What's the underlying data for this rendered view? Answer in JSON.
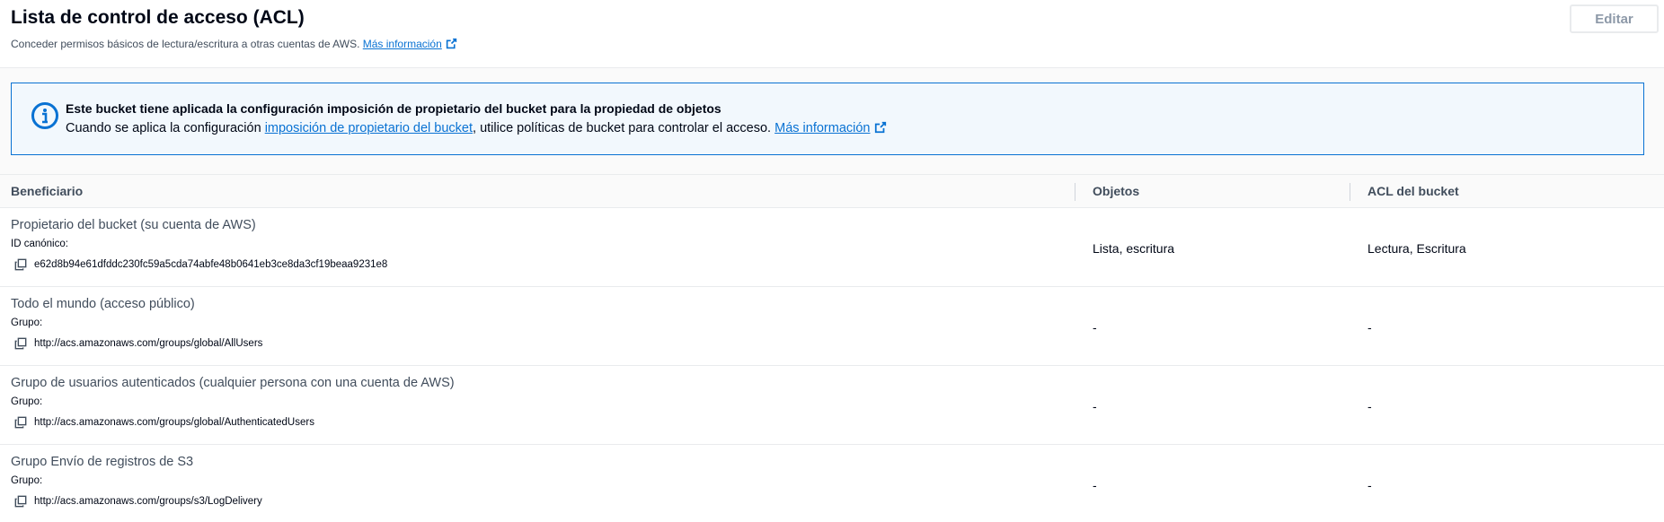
{
  "header": {
    "title": "Lista de control de acceso (ACL)",
    "description": "Conceder permisos básicos de lectura/escritura a otras cuentas de AWS.",
    "more_info_link": "Más información",
    "edit_button": "Editar"
  },
  "info_alert": {
    "icon": "info-icon",
    "title": "Este bucket tiene aplicada la configuración imposición de propietario del bucket para la propiedad de objetos",
    "body_prefix": "Cuando se aplica la configuración",
    "body_link": "imposición de propietario del bucket",
    "body_suffix": ", utilice políticas de bucket para controlar el acceso.",
    "more_info_link": "Más información"
  },
  "table": {
    "columns": [
      "Beneficiario",
      "Objetos",
      "ACL del bucket"
    ],
    "rows": [
      {
        "grantee": "Propietario del bucket (su cuenta de AWS)",
        "id_label": "ID canónico:",
        "id_value": "e62d8b94e61dfddc230fc59a5cda74abfe48b0641eb3ce8da3cf19beaa9231e8",
        "objects": "Lista, escritura",
        "bucket_acl": "Lectura, Escritura"
      },
      {
        "grantee": "Todo el mundo (acceso público)",
        "id_label": "Grupo:",
        "id_value": "http://acs.amazonaws.com/groups/global/AllUsers",
        "objects": "-",
        "bucket_acl": "-"
      },
      {
        "grantee": "Grupo de usuarios autenticados (cualquier persona con una cuenta de AWS)",
        "id_label": "Grupo:",
        "id_value": "http://acs.amazonaws.com/groups/global/AuthenticatedUsers",
        "objects": "-",
        "bucket_acl": "-"
      },
      {
        "grantee": "Grupo Envío de registros de S3",
        "id_label": "Grupo:",
        "id_value": "http://acs.amazonaws.com/groups/s3/LogDelivery",
        "objects": "-",
        "bucket_acl": "-"
      }
    ]
  },
  "colors": {
    "link": "#0972d3",
    "alert_border": "#0972d3",
    "alert_bg": "#f2f8fd",
    "text": "#000716",
    "muted_text": "#414d5c"
  }
}
